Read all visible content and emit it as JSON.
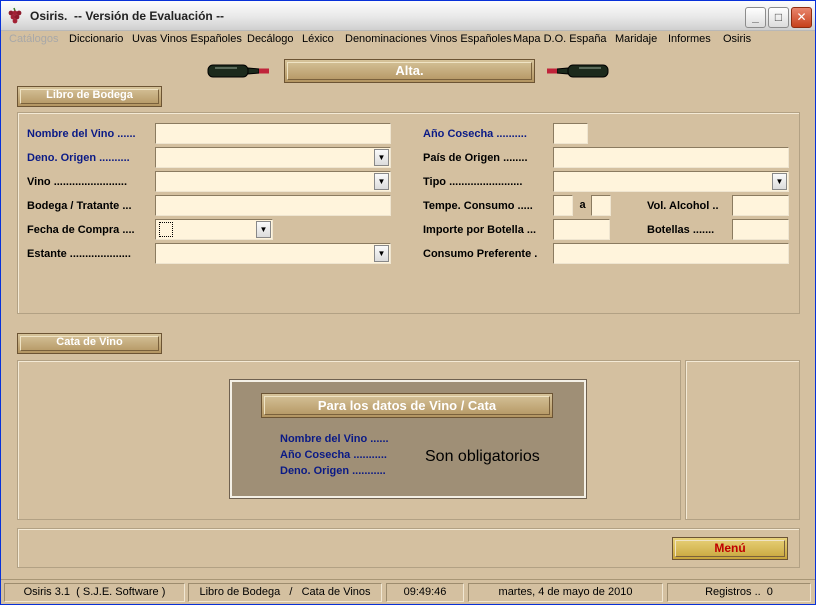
{
  "window": {
    "title": "Osiris.  -- Versión de Evaluación --",
    "min_symbol": "_",
    "max_symbol": "□",
    "close_symbol": "✕"
  },
  "menu": [
    {
      "label": "Catálogos",
      "enabled": false
    },
    {
      "label": "Diccionario",
      "enabled": true
    },
    {
      "label": "Uvas Vinos Españoles",
      "enabled": true
    },
    {
      "label": "Decálogo",
      "enabled": true
    },
    {
      "label": "Léxico",
      "enabled": true
    },
    {
      "label": "Denominaciones Vinos Españoles",
      "enabled": true
    },
    {
      "label": "Mapa D.O. España",
      "enabled": true
    },
    {
      "label": "Maridaje",
      "enabled": true
    },
    {
      "label": "Informes",
      "enabled": true
    },
    {
      "label": "Osiris",
      "enabled": true
    }
  ],
  "header": {
    "mode_label": "Alta."
  },
  "libro": {
    "group_label": "Libro de Bodega",
    "left": [
      {
        "label": "Nombre del Vino ......",
        "value": "",
        "type": "text",
        "required": true
      },
      {
        "label": "Deno. Origen ..........",
        "value": "",
        "type": "dropdown",
        "required": true
      },
      {
        "label": "Vino ........................",
        "value": "",
        "type": "dropdown",
        "required": false
      },
      {
        "label": "Bodega / Tratante ...",
        "value": "",
        "type": "text",
        "required": false
      },
      {
        "label": "Fecha de Compra ....",
        "value": "",
        "type": "date",
        "required": false
      },
      {
        "label": "Estante ....................",
        "value": "",
        "type": "dropdown",
        "required": false
      }
    ],
    "right": {
      "ano_cosecha_label": "Año Cosecha ..........",
      "pais_label": "País de Origen ........",
      "tipo_label": "Tipo ........................",
      "tempe_label": "Tempe. Consumo .....",
      "tempe_sep": "a",
      "vol_label": "Vol. Alcohol ..",
      "importe_label": "Importe por Botella ...",
      "botellas_label": "Botellas .......",
      "consumo_label": "Consumo Preferente ."
    }
  },
  "cata": {
    "group_label": "Cata de Vino",
    "notice_title": "Para los datos de Vino / Cata",
    "notice_items": [
      "Nombre del Vino ......",
      "Año Cosecha ...........",
      "Deno. Origen ..........."
    ],
    "notice_text": "Son obligatorios"
  },
  "footer": {
    "menu_button": "Menú"
  },
  "status": {
    "app": "Osiris 3.1  ( S.J.E. Software )",
    "section": "Libro de Bodega   /   Cata de Vinos",
    "time": "09:49:46",
    "date": "martes, 4 de mayo de 2010",
    "records": "Registros ..  0"
  },
  "colors": {
    "background": "#d4c0a0",
    "field": "#fff4dc",
    "required_label": "#0a1a86",
    "menu_button_text": "#c00000"
  },
  "icons": [
    "grape-app-icon",
    "wine-bottle-icon",
    "dropdown-arrow-icon"
  ]
}
